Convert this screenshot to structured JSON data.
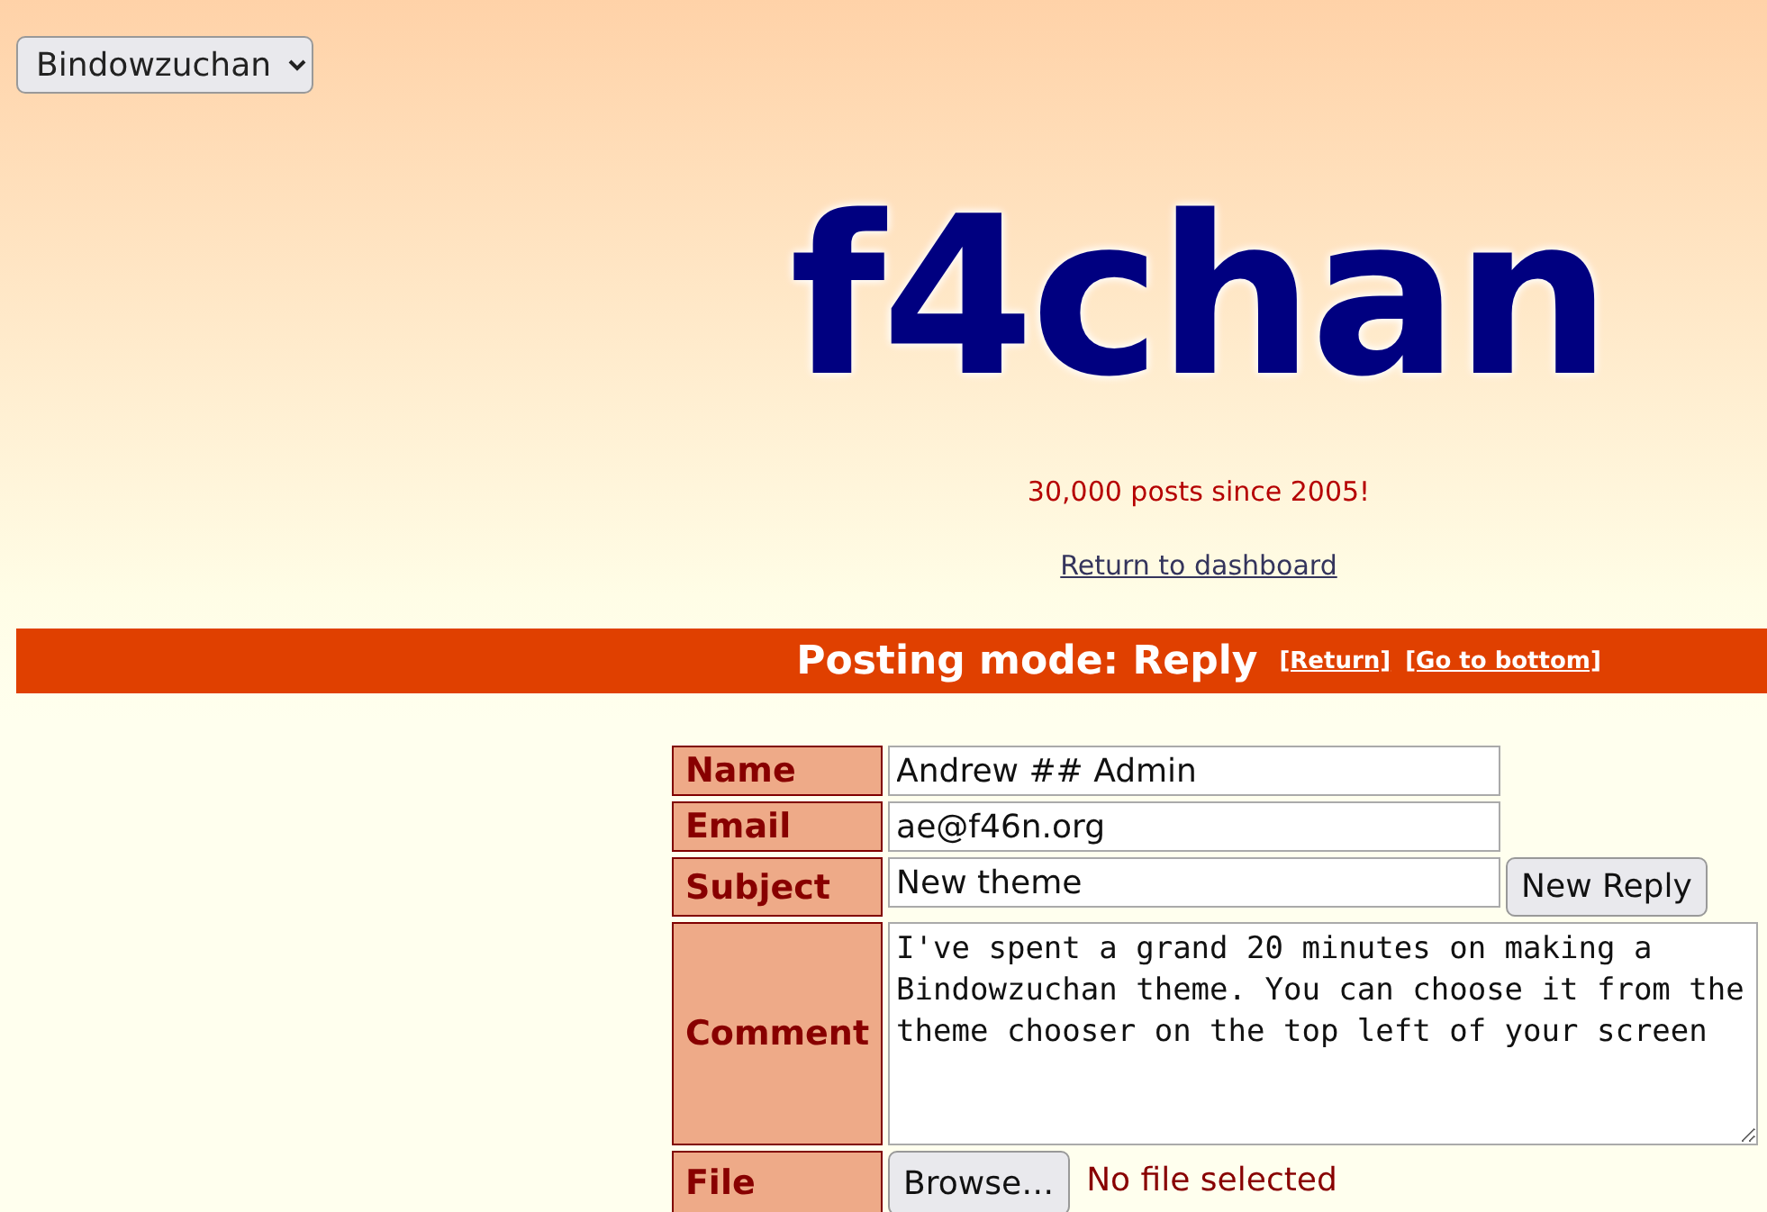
{
  "theme_selector": {
    "value": "Bindowzuchan"
  },
  "logo": "f4chan",
  "tagline": "30,000 posts since 2005!",
  "dashboard_link": "Return to dashboard",
  "posting_bar": {
    "title": "Posting mode: Reply",
    "links": [
      "[Return]",
      "[Go to bottom]"
    ]
  },
  "form": {
    "rows": [
      {
        "label": "Name",
        "kind": "text",
        "value": "Andrew ## Admin"
      },
      {
        "label": "Email",
        "kind": "text",
        "value": "ae@f46n.org"
      },
      {
        "label": "Subject",
        "kind": "text",
        "value": "New theme",
        "button": "New Reply"
      },
      {
        "label": "Comment",
        "kind": "textarea",
        "value": "I've spent a grand 20 minutes on making a Bindowzuchan theme. You can choose it from the theme chooser on the top left of your screen"
      },
      {
        "label": "File",
        "kind": "file",
        "button": "Browse…",
        "status": "No file selected"
      }
    ]
  }
}
